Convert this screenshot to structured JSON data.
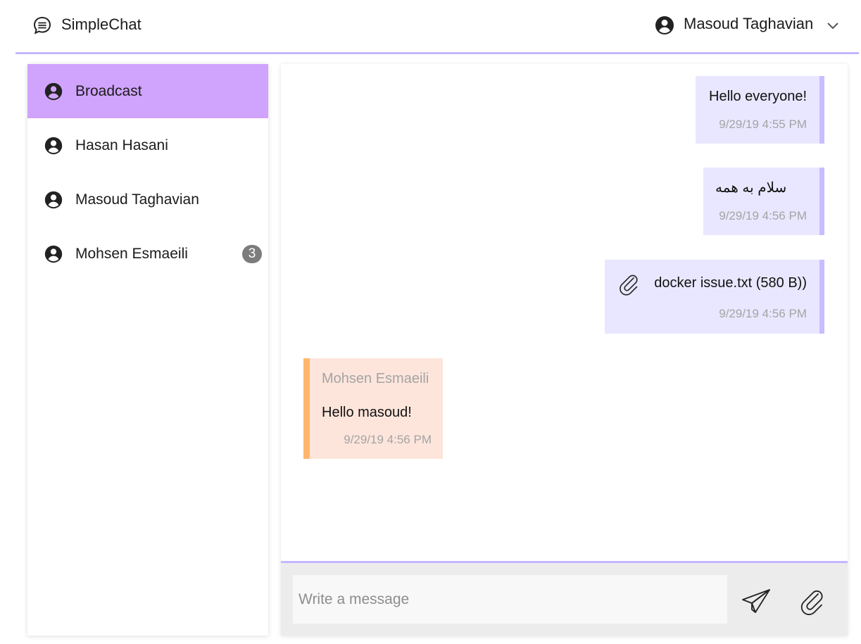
{
  "app": {
    "title": "SimpleChat",
    "brand_icon": "chat-bubble-icon"
  },
  "user": {
    "name": "Masoud Taghavian",
    "avatar_icon": "account-circle-icon",
    "menu_icon": "chevron-down-icon"
  },
  "colors": {
    "accent": "#c5b6ff",
    "active_contact": "#d0a3fd",
    "outgoing_bubble": "#e9e7ff",
    "outgoing_border": "#c9bdff",
    "incoming_bubble": "#fde5db",
    "incoming_border": "#ffb86b",
    "badge": "#7c7c7c"
  },
  "sidebar": {
    "contacts": [
      {
        "name": "Broadcast",
        "active": true,
        "icon": "account-circle-icon"
      },
      {
        "name": "Hasan Hasani",
        "icon": "account-circle-icon"
      },
      {
        "name": "Masoud Taghavian",
        "icon": "account-circle-icon"
      },
      {
        "name": "Mohsen Esmaeili",
        "unread": "3",
        "icon": "account-circle-icon"
      }
    ]
  },
  "messages": [
    {
      "direction": "outgoing",
      "text": "Hello everyone!",
      "time": "9/29/19 4:55 PM"
    },
    {
      "direction": "outgoing",
      "text": "سلام به همه",
      "time": "9/29/19 4:56 PM"
    },
    {
      "direction": "outgoing",
      "type": "file",
      "icon": "paperclip-icon",
      "text": "docker issue.txt (580 B))",
      "time": "9/29/19 4:56 PM"
    },
    {
      "direction": "incoming",
      "sender": "Mohsen Esmaeili",
      "text": "Hello masoud!",
      "time": "9/29/19 4:56 PM"
    }
  ],
  "composer": {
    "placeholder": "Write a message",
    "value": "",
    "send_icon": "send-icon",
    "attach_icon": "paperclip-icon"
  }
}
